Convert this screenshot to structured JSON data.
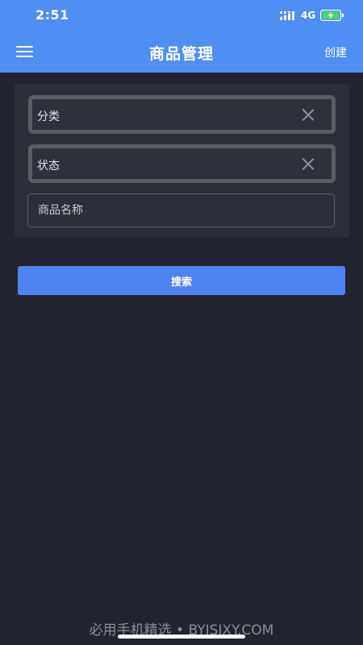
{
  "status_bar": {
    "time": "2:51",
    "network": "4G",
    "icons": [
      "signal-icon",
      "battery-charging-icon"
    ],
    "battery_color": "#4cd964"
  },
  "navbar": {
    "menu_icon": "hamburger-menu-icon",
    "title": "商品管理",
    "create_label": "创建",
    "background": "#4f8ef2"
  },
  "filters": {
    "category_label": "分类",
    "status_label": "状态",
    "name_placeholder": "商品名称",
    "clear_icon": "close-icon"
  },
  "search_button_label": "搜索",
  "watermark": "必用手机精选 • BYJSJXY.COM",
  "colors": {
    "background": "#222430",
    "panel": "#2c2e3a",
    "accent": "#4e82f0"
  }
}
